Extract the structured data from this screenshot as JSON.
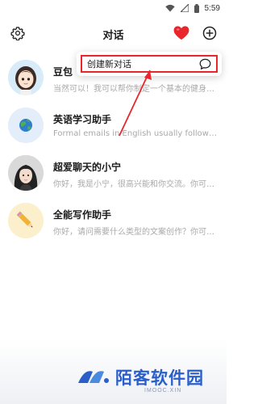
{
  "status_bar": {
    "time": "5:59",
    "icons": [
      "wifi-icon",
      "signal-icon",
      "battery-icon"
    ]
  },
  "header": {
    "title": "对话",
    "icons": [
      "gear-icon",
      "heart-icon",
      "add-circle-icon"
    ],
    "accent_color": "#e8262c"
  },
  "popup_menu": {
    "items": [
      {
        "label": "创建新对话",
        "icon": "chat-bubble-icon"
      }
    ],
    "highlight_color": "#e8262c"
  },
  "chats": [
    {
      "title": "豆包",
      "preview": "当然可以！我可以帮你制定一个基本的健身计划…",
      "avatar": "doubao-avatar"
    },
    {
      "title": "英语学习助手",
      "preview": "Formal emails in English usually follow a certain structure…",
      "avatar": "globe-avatar"
    },
    {
      "title": "超爱聊天的小宁",
      "preview": "你好，我是小宁，很高兴能和你交流。你可以…",
      "avatar": "girl-avatar"
    },
    {
      "title": "全能写作助手",
      "preview": "你好，请问需要什么类型的文案创作？你可以…",
      "avatar": "pencil-avatar"
    }
  ],
  "watermark": {
    "title": "陌客软件园",
    "url": "IMOOC.XIN",
    "color": "#2a5ec9"
  }
}
